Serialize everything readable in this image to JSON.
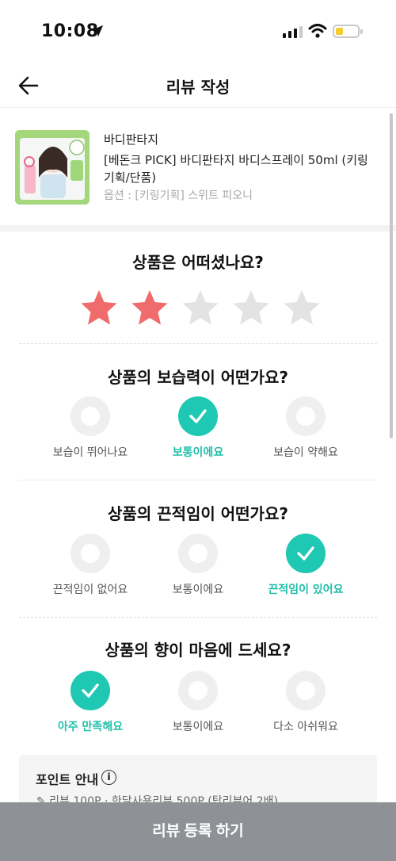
{
  "status_bar": {
    "time": "10:08"
  },
  "header": {
    "title": "리뷰 작성"
  },
  "product": {
    "brand": "바디판타지",
    "name": "[베돈크 PICK] 바디판타지 바디스프레이 50ml (키링 기획/단품)",
    "option": "옵션 : [키링기획] 스위트 피오니"
  },
  "rating": {
    "question": "상품은 어떠셨나요?",
    "value": 2,
    "max": 5,
    "active_color": "#f06b6b",
    "inactive_color": "#e3e3e3"
  },
  "questions": [
    {
      "title": "상품의 보습력이 어떤가요?",
      "options": [
        "보습이 뛰어나요",
        "보통이에요",
        "보습이 약해요"
      ],
      "selected": 1
    },
    {
      "title": "상품의 끈적임이 어떤가요?",
      "options": [
        "끈적임이 없어요",
        "보통이에요",
        "끈적임이 있어요"
      ],
      "selected": 2
    },
    {
      "title": "상품의 향이 마음에 드세요?",
      "options": [
        "아주 만족해요",
        "보통이에요",
        "다소 아쉬워요"
      ],
      "selected": 0
    }
  ],
  "point_guide": {
    "title": "포인트 안내",
    "info_icon": "i",
    "line": "✎ 리뷰 100P · 한달사용리뷰 500P (탑리뷰어 2배)"
  },
  "submit": {
    "label": "리뷰 등록 하기"
  },
  "colors": {
    "accent": "#1fc8b2",
    "button": "#8e9296"
  }
}
